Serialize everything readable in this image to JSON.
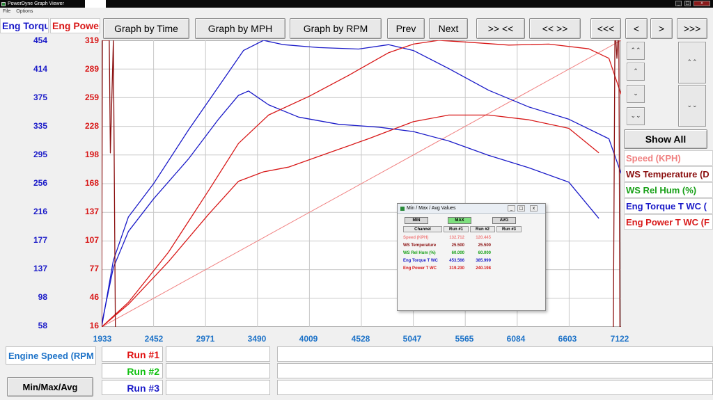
{
  "window": {
    "title": "PowerDyne Graph Viewer",
    "min": "_",
    "max": "□",
    "close": "x"
  },
  "menu": [
    "File",
    "Options"
  ],
  "y_boxes": {
    "torque": "Eng Torque",
    "power": "Eng Power"
  },
  "toolbar": {
    "graph_by_time": "Graph by Time",
    "graph_by_mph": "Graph by MPH",
    "graph_by_rpm": "Graph by RPM",
    "prev": "Prev",
    "next": "Next",
    "zoom_in": ">> <<",
    "zoom_out": "<< >>",
    "scroll_far_left": "<<<",
    "scroll_left": "<",
    "scroll_right": ">",
    "scroll_far_right": ">>>"
  },
  "side_controls": {
    "show_all": "Show All",
    "up_up": "⌃⌃",
    "up": "⌃",
    "down": "⌄",
    "down_down": "⌄⌄",
    "tall_up": "⌃⌃",
    "tall_down": "⌄⌄"
  },
  "legend": [
    {
      "label": "Speed (KPH)",
      "color": "#f08080"
    },
    {
      "label": "WS Temperature (D",
      "color": "#8b1010"
    },
    {
      "label": "WS Rel Hum (%)",
      "color": "#18a018"
    },
    {
      "label": "Eng Torque T WC (",
      "color": "#1a1ac8"
    },
    {
      "label": "Eng Power T WC (F",
      "color": "#d81818"
    }
  ],
  "bottom": {
    "x_channel": "Engine Speed (RPM",
    "runs": [
      {
        "label": "Run #1",
        "color": "#e01010"
      },
      {
        "label": "Run #2",
        "color": "#10c010"
      },
      {
        "label": "Run #3",
        "color": "#1a1ac8"
      }
    ],
    "minmax_button": "Min/Max/Avg"
  },
  "dialog": {
    "title": "Min / Max / Avg Values",
    "buttons": {
      "min": "MIN",
      "max": "MAX",
      "avg": "AVG"
    },
    "headers": [
      "Channel",
      "Run #1",
      "Run #2",
      "Run #3"
    ],
    "rows": [
      {
        "channel": "Speed (KPH)",
        "run1": "132.712",
        "run2": "120.445",
        "run3": "",
        "color": "#f08080"
      },
      {
        "channel": "WS Temperature",
        "run1": "25.500",
        "run2": "25.500",
        "run3": "",
        "color": "#8b1010"
      },
      {
        "channel": "WS Rel Hum (%)",
        "run1": "60.000",
        "run2": "60.000",
        "run3": "",
        "color": "#18a018"
      },
      {
        "channel": "Eng Torque T WC",
        "run1": "453.566",
        "run2": "385.999",
        "run3": "",
        "color": "#1a1ac8"
      },
      {
        "channel": "Eng Power T WC",
        "run1": "319.230",
        "run2": "240.198",
        "run3": "",
        "color": "#d81818"
      }
    ]
  },
  "chart_data": {
    "type": "line",
    "x_ticks": [
      "1933",
      "2452",
      "2971",
      "3490",
      "4009",
      "4528",
      "5047",
      "5565",
      "6084",
      "6603",
      "7122"
    ],
    "xlim": [
      1933,
      7122
    ],
    "y_left_ticks": [
      "454",
      "414",
      "375",
      "335",
      "295",
      "256",
      "216",
      "177",
      "137",
      "98",
      "58"
    ],
    "y_left_color": "#1a1ac8",
    "ylim_left": [
      58,
      454
    ],
    "y_right_ticks": [
      "319",
      "289",
      "259",
      "228",
      "198",
      "168",
      "137",
      "107",
      "77",
      "46",
      "16"
    ],
    "y_right_color": "#d81818",
    "ylim_right": [
      16,
      319
    ],
    "grid": true,
    "series": [
      {
        "name": "Speed (KPH)",
        "color": "#f08080",
        "axis": "power",
        "width": 1,
        "x": [
          1933,
          7122
        ],
        "y": [
          16,
          319
        ]
      },
      {
        "name": "Eng Torque T WC",
        "run": 1,
        "color": "#1a1ac8",
        "axis": "torque",
        "width": 1.3,
        "x": [
          1933,
          2050,
          2200,
          2452,
          2800,
          3100,
          3350,
          3550,
          3750,
          4100,
          4500,
          4800,
          5047,
          5400,
          5800,
          6200,
          6600,
          7000,
          7122
        ],
        "y": [
          58,
          150,
          210,
          256,
          330,
          390,
          440,
          454,
          448,
          444,
          442,
          448,
          440,
          415,
          385,
          362,
          345,
          318,
          270
        ]
      },
      {
        "name": "Eng Torque T WC",
        "run": 2,
        "color": "#1a1ac8",
        "axis": "torque",
        "width": 1.3,
        "x": [
          1933,
          2050,
          2200,
          2452,
          2800,
          3100,
          3300,
          3400,
          3600,
          3900,
          4300,
          4700,
          5047,
          5400,
          5800,
          6200,
          6600,
          6900
        ],
        "y": [
          62,
          140,
          190,
          235,
          290,
          345,
          378,
          384,
          365,
          348,
          338,
          334,
          328,
          315,
          295,
          278,
          258,
          208
        ]
      },
      {
        "name": "Eng Power T WC",
        "run": 1,
        "color": "#d81818",
        "axis": "power",
        "width": 1.3,
        "x": [
          1933,
          2200,
          2600,
          3000,
          3300,
          3600,
          4009,
          4400,
          4800,
          5047,
          5300,
          5600,
          6000,
          6400,
          6800,
          7000,
          7122
        ],
        "y": [
          16,
          42,
          95,
          160,
          210,
          240,
          260,
          282,
          306,
          315,
          319,
          317,
          314,
          315,
          310,
          300,
          262
        ]
      },
      {
        "name": "Eng Power T WC",
        "run": 2,
        "color": "#d81818",
        "axis": "power",
        "width": 1.3,
        "x": [
          1933,
          2200,
          2600,
          3000,
          3300,
          3550,
          3800,
          4200,
          4600,
          5047,
          5400,
          5800,
          6200,
          6600,
          6900
        ],
        "y": [
          16,
          40,
          85,
          135,
          170,
          180,
          185,
          200,
          215,
          233,
          240,
          240,
          235,
          226,
          200
        ]
      },
      {
        "name": "WS Temperature",
        "run": 1,
        "color": "#8b1010",
        "axis": "power",
        "width": 1.3,
        "x": [
          1933,
          1940,
          2009,
          2020,
          2050,
          2070
        ],
        "y": [
          16,
          319,
          319,
          200,
          319,
          16
        ]
      },
      {
        "name": "WS Temperature",
        "run": 2,
        "color": "#8b1010",
        "axis": "power",
        "width": 1.3,
        "x": [
          7045,
          7060,
          7070,
          7080,
          7090,
          7100,
          7110,
          7122
        ],
        "y": [
          16,
          319,
          319,
          300,
          319,
          319,
          16,
          16
        ]
      }
    ]
  }
}
